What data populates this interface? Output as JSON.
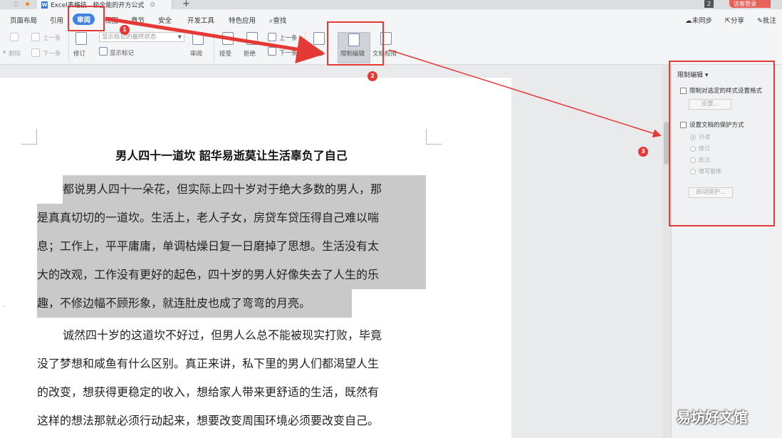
{
  "tabstrip": {
    "doc_tab_title": "Excel表格技...极全能的开方公式",
    "badge_count": "2",
    "guest_label": "访客登录",
    "new_tab": "+"
  },
  "menu": {
    "items": [
      "页面布局",
      "引用",
      "审阅",
      "视图",
      "章节",
      "安全",
      "开发工具",
      "特色应用",
      "查找"
    ],
    "active": "审阅",
    "right": [
      "未同步",
      "分享",
      "批注"
    ]
  },
  "ribbon": {
    "prev_label": "上一条",
    "next_label": "下一条",
    "delete_label": "删除",
    "revise_label": "修订",
    "markup_select": "显示标记的最终状态",
    "show_markup_label": "显示标记",
    "review_label": "审阅",
    "accept_label": "接受",
    "reject_label": "拒绝",
    "prev2_label": "上一条",
    "next2_label": "下一条",
    "compare_label": "比较",
    "restrict_label": "限制编辑",
    "docperm_label": "文档权限"
  },
  "document": {
    "title": "男人四十一道坎  韶华易逝莫让生活辜负了自己",
    "para1": [
      "都说男人四十一朵花，但实际上四十岁对于绝大多数的男人，那",
      "是真真切切的一道坎。生活上，老人子女，房贷车贷压得自己难以喘",
      "息；工作上，平平庸庸，单调枯燥日复一日磨掉了思想。生活没有太",
      "大的改观，工作没有更好的起色，四十岁的男人好像失去了人生的乐",
      "趣，不修边幅不顾形象，就连肚皮也成了弯弯的月亮。"
    ],
    "para2": [
      "诚然四十岁的这道坎不好过，但男人么总不能被现实打败，毕竟",
      "没了梦想和咸鱼有什么区别。真正来讲，私下里的男人们都渴望人生",
      "的改变，想获得更稳定的收入，想给家人带来更舒适的生活，既然有",
      "这样的想法那就必须行动起来，想要改变周围环境必须要改变自己。"
    ]
  },
  "pane": {
    "title": "限制编辑",
    "opt1_label": "限制对选定的样式设置格式",
    "settings_button": "设置...",
    "opt2_label": "设置文档的保护方式",
    "radios": [
      "只读",
      "修订",
      "批注",
      "填写窗体"
    ],
    "start_button": "启动保护..."
  },
  "annotations": {
    "step1": "1",
    "step2": "2",
    "step3": "3",
    "accent_color": "#e53935"
  },
  "watermark": "易坊好文馆"
}
